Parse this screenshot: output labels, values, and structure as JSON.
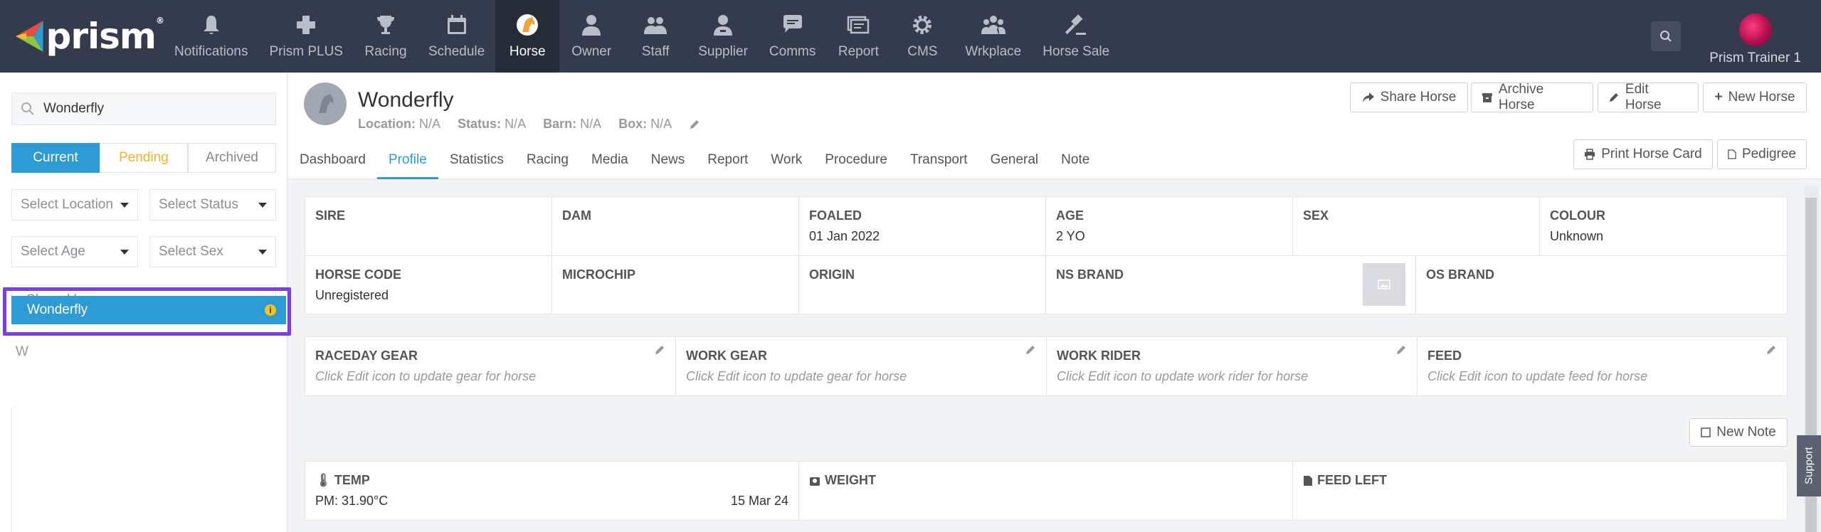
{
  "brand": {
    "name": "prism",
    "mark": "®"
  },
  "nav": [
    {
      "label": "Notifications",
      "icon": "bell-icon"
    },
    {
      "label": "Prism PLUS",
      "icon": "plus-cross-icon"
    },
    {
      "label": "Racing",
      "icon": "trophy-icon"
    },
    {
      "label": "Schedule",
      "icon": "calendar-icon"
    },
    {
      "label": "Horse",
      "icon": "horse-icon",
      "active": true
    },
    {
      "label": "Owner",
      "icon": "owner-icon"
    },
    {
      "label": "Staff",
      "icon": "staff-icon"
    },
    {
      "label": "Supplier",
      "icon": "supplier-icon"
    },
    {
      "label": "Comms",
      "icon": "chat-icon"
    },
    {
      "label": "Report",
      "icon": "report-icon"
    },
    {
      "label": "CMS",
      "icon": "gear-icon"
    },
    {
      "label": "Wrkplace",
      "icon": "group-icon"
    },
    {
      "label": "Horse Sale",
      "icon": "gavel-icon"
    }
  ],
  "user": {
    "name": "Prism Trainer 1"
  },
  "sidebar": {
    "search_value": "Wonderfly",
    "filters": {
      "current": "Current",
      "pending": "Pending",
      "archived": "Archived"
    },
    "select_location": "Select Location",
    "select_status": "Select Status",
    "select_age": "Select Age",
    "select_sex": "Select Sex",
    "shared_by": "Shared by",
    "group_letter": "W",
    "horse_item": "Wonderfly",
    "info_badge": "i"
  },
  "horse": {
    "name": "Wonderfly",
    "location_label": "Location:",
    "location": "N/A",
    "status_label": "Status:",
    "status": "N/A",
    "barn_label": "Barn:",
    "barn": "N/A",
    "box_label": "Box:",
    "box": "N/A"
  },
  "actions": {
    "share": "Share Horse",
    "archive": "Archive Horse",
    "edit": "Edit Horse",
    "new": "New Horse",
    "print": "Print Horse Card",
    "pedigree": "Pedigree"
  },
  "tabs": [
    "Dashboard",
    "Profile",
    "Statistics",
    "Racing",
    "Media",
    "News",
    "Report",
    "Work",
    "Procedure",
    "Transport",
    "General",
    "Note"
  ],
  "profile": {
    "sire_label": "SIRE",
    "sire": "",
    "dam_label": "DAM",
    "dam": "",
    "foaled_label": "FOALED",
    "foaled": "01 Jan 2022",
    "age_label": "AGE",
    "age": "2 YO",
    "sex_label": "SEX",
    "sex": "",
    "colour_label": "COLOUR",
    "colour": "Unknown",
    "horse_code_label": "HORSE CODE",
    "horse_code": "Unregistered",
    "microchip_label": "MICROCHIP",
    "microchip": "",
    "origin_label": "ORIGIN",
    "origin": "",
    "ns_brand_label": "NS BRAND",
    "os_brand_label": "OS BRAND"
  },
  "gear": {
    "raceday_label": "RACEDAY GEAR",
    "raceday_hint": "Click Edit icon to update gear for horse",
    "work_gear_label": "WORK GEAR",
    "work_gear_hint": "Click Edit icon to update gear for horse",
    "work_rider_label": "WORK RIDER",
    "work_rider_hint": "Click Edit icon to update work rider for horse",
    "feed_label": "FEED",
    "feed_hint": "Click Edit icon to update feed for horse"
  },
  "new_note": "New Note",
  "vitals": {
    "temp_label": "TEMP",
    "temp_value": "PM: 31.90°C",
    "temp_date": "15 Mar 24",
    "weight_label": "WEIGHT",
    "feed_left_label": "FEED LEFT"
  },
  "support": "Support"
}
